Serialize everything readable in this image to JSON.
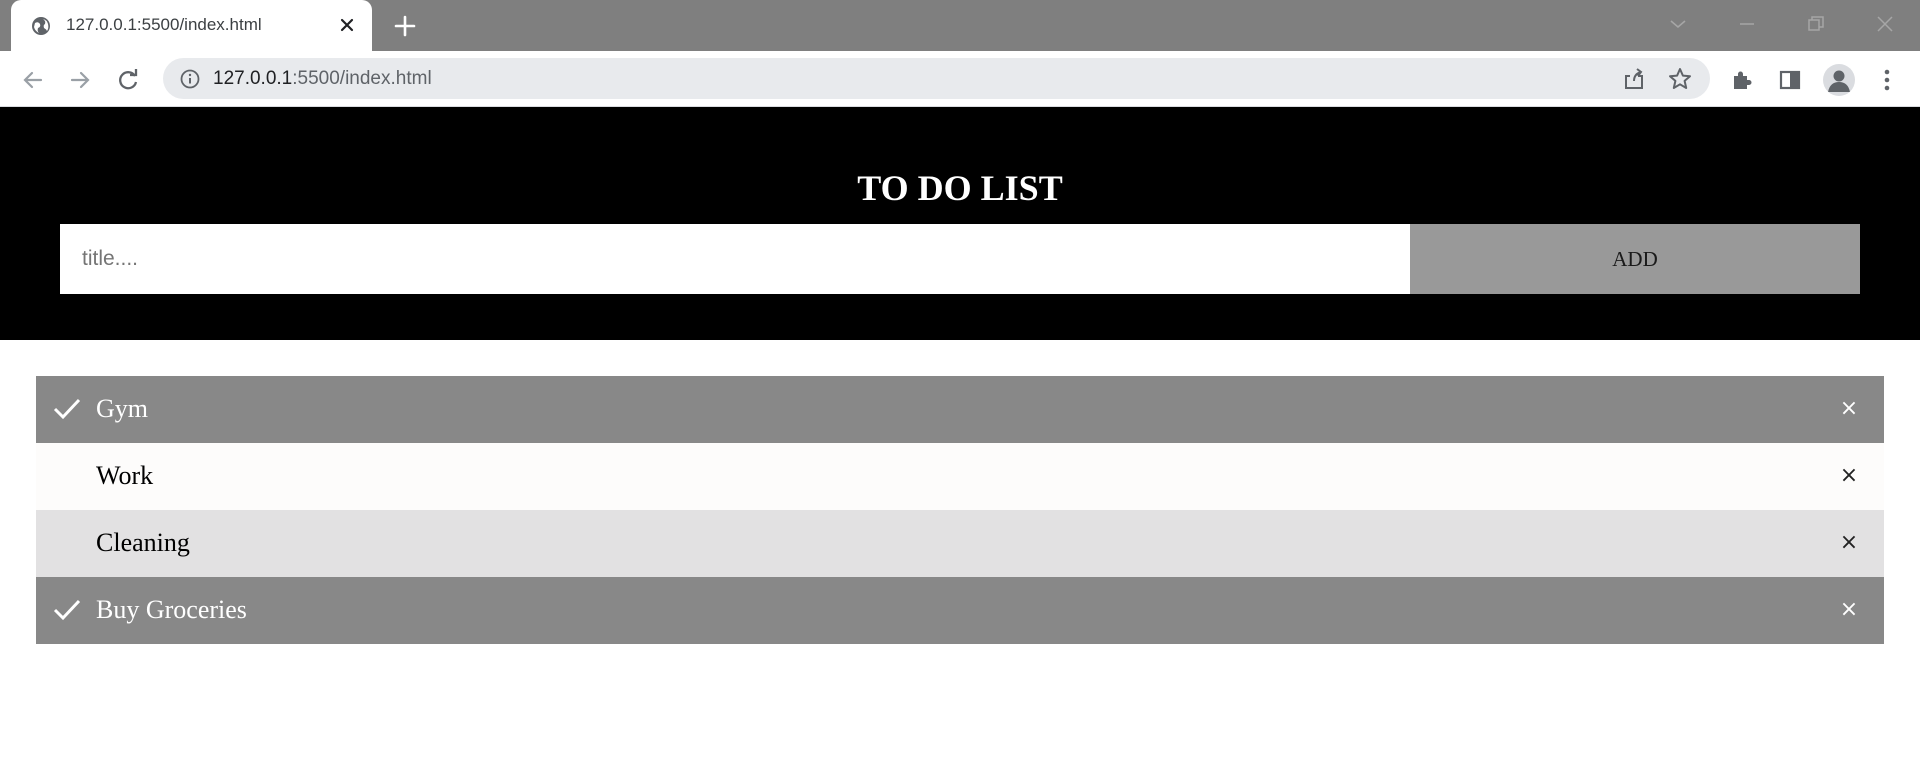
{
  "browser": {
    "tab": {
      "title": "127.0.0.1:5500/index.html",
      "favicon_icon": "globe-icon",
      "close_icon": "close-icon"
    },
    "new_tab_icon": "plus-icon",
    "window_controls": [
      "chevron-down-icon",
      "minimize-icon",
      "restore-icon",
      "close-icon"
    ],
    "nav": [
      "back-arrow-icon",
      "forward-arrow-icon",
      "reload-icon"
    ],
    "address_bar": {
      "host": "127.0.0.1",
      "path": ":5500/index.html",
      "info_icon": "info-icon"
    },
    "toolbar_icons": [
      "share-icon",
      "star-icon",
      "extensions-icon",
      "side-panel-icon",
      "profile-avatar-icon",
      "more-vert-icon"
    ]
  },
  "app": {
    "title": "TO DO LIST",
    "input": {
      "placeholder": "title....",
      "value": ""
    },
    "add_label": "ADD",
    "colors": {
      "header_bg": "#000000",
      "add_button_bg": "#999999",
      "checked_row_bg": "#888888",
      "odd_row_bg": "#fdfcfb",
      "even_row_bg": "#e2e1e2"
    },
    "items": [
      {
        "text": "Gym",
        "checked": true,
        "close_label": "×"
      },
      {
        "text": "Work",
        "checked": false,
        "close_label": "×"
      },
      {
        "text": "Cleaning",
        "checked": false,
        "close_label": "×"
      },
      {
        "text": "Buy Groceries",
        "checked": true,
        "close_label": "×"
      }
    ]
  }
}
